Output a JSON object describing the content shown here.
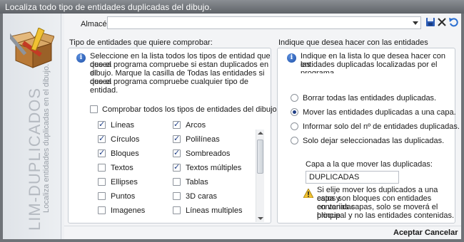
{
  "window": {
    "title": "Localiza todo tipo de entidades duplicadas del dibujo."
  },
  "sidebar": {
    "title": "LIM-DUPLICADOS",
    "subtitle": "Localiza entidades duplicadas en el dibujo."
  },
  "almacen": {
    "label": "Almacén",
    "value": ""
  },
  "toolbar": {
    "save_icon": "save-icon",
    "close_icon": "close-icon",
    "undo_icon": "undo-icon"
  },
  "left_group": {
    "title": "Tipo de entidades que quiere comprobar:",
    "info_text_1": "Seleccione en la lista todos los tipos de entidad que desea",
    "info_text_2": "que el programa compruebe si estan duplicados en el",
    "info_text_3": "dibujo. Marque la casilla de Todas las entidades si desea",
    "info_text_4": "que el programa compruebe cualquier tipo de entidad.",
    "check_all_label": "Comprobar todos los tipos de entidades del dibujo.",
    "check_all_checked": false,
    "col1": [
      {
        "label": "Líneas",
        "checked": true
      },
      {
        "label": "Círculos",
        "checked": true
      },
      {
        "label": "Bloques",
        "checked": true
      },
      {
        "label": "Textos",
        "checked": false
      },
      {
        "label": "Ellipses",
        "checked": false
      },
      {
        "label": "Puntos",
        "checked": false
      },
      {
        "label": "Imagenes",
        "checked": false
      }
    ],
    "col2": [
      {
        "label": "Arcos",
        "checked": true
      },
      {
        "label": "Polilíneas",
        "checked": true
      },
      {
        "label": "Sombreados",
        "checked": true
      },
      {
        "label": "Textos múltiples",
        "checked": true
      },
      {
        "label": "Tablas",
        "checked": false
      },
      {
        "label": "3D caras",
        "checked": false
      },
      {
        "label": "Líneas multiples",
        "checked": false
      }
    ]
  },
  "right_group": {
    "title": "Indique que desea hacer con las entidades duplicadas:",
    "info_text_1": "Indique en la lista lo que desea hacer con las",
    "info_text_2": "entidades duplicadas localizadas por el",
    "info_text_3": "programa",
    "options": [
      {
        "label": "Borrar todas las entidades duplicadas.",
        "checked": false
      },
      {
        "label": "Mover las entidades duplicadas a una capa.",
        "checked": true
      },
      {
        "label": "Informar solo del nº de entidades duplicadas.",
        "checked": false
      },
      {
        "label": "Solo dejar seleccionadas las duplicadas.",
        "checked": false
      }
    ],
    "layer_label": "Capa a la que mover las duplicadas:",
    "layer_value": "DUPLICADAS",
    "warning_1": "Si elije mover los duplicados a una capa y",
    "warning_2": "estos son bloques con entidades contenidas",
    "warning_3": "en varias capas, solo se moverá el bloque",
    "warning_4": "principal y no las entidades contenidas."
  },
  "footer": {
    "accept_label": "Aceptar",
    "cancel_label": "Cancelar"
  }
}
